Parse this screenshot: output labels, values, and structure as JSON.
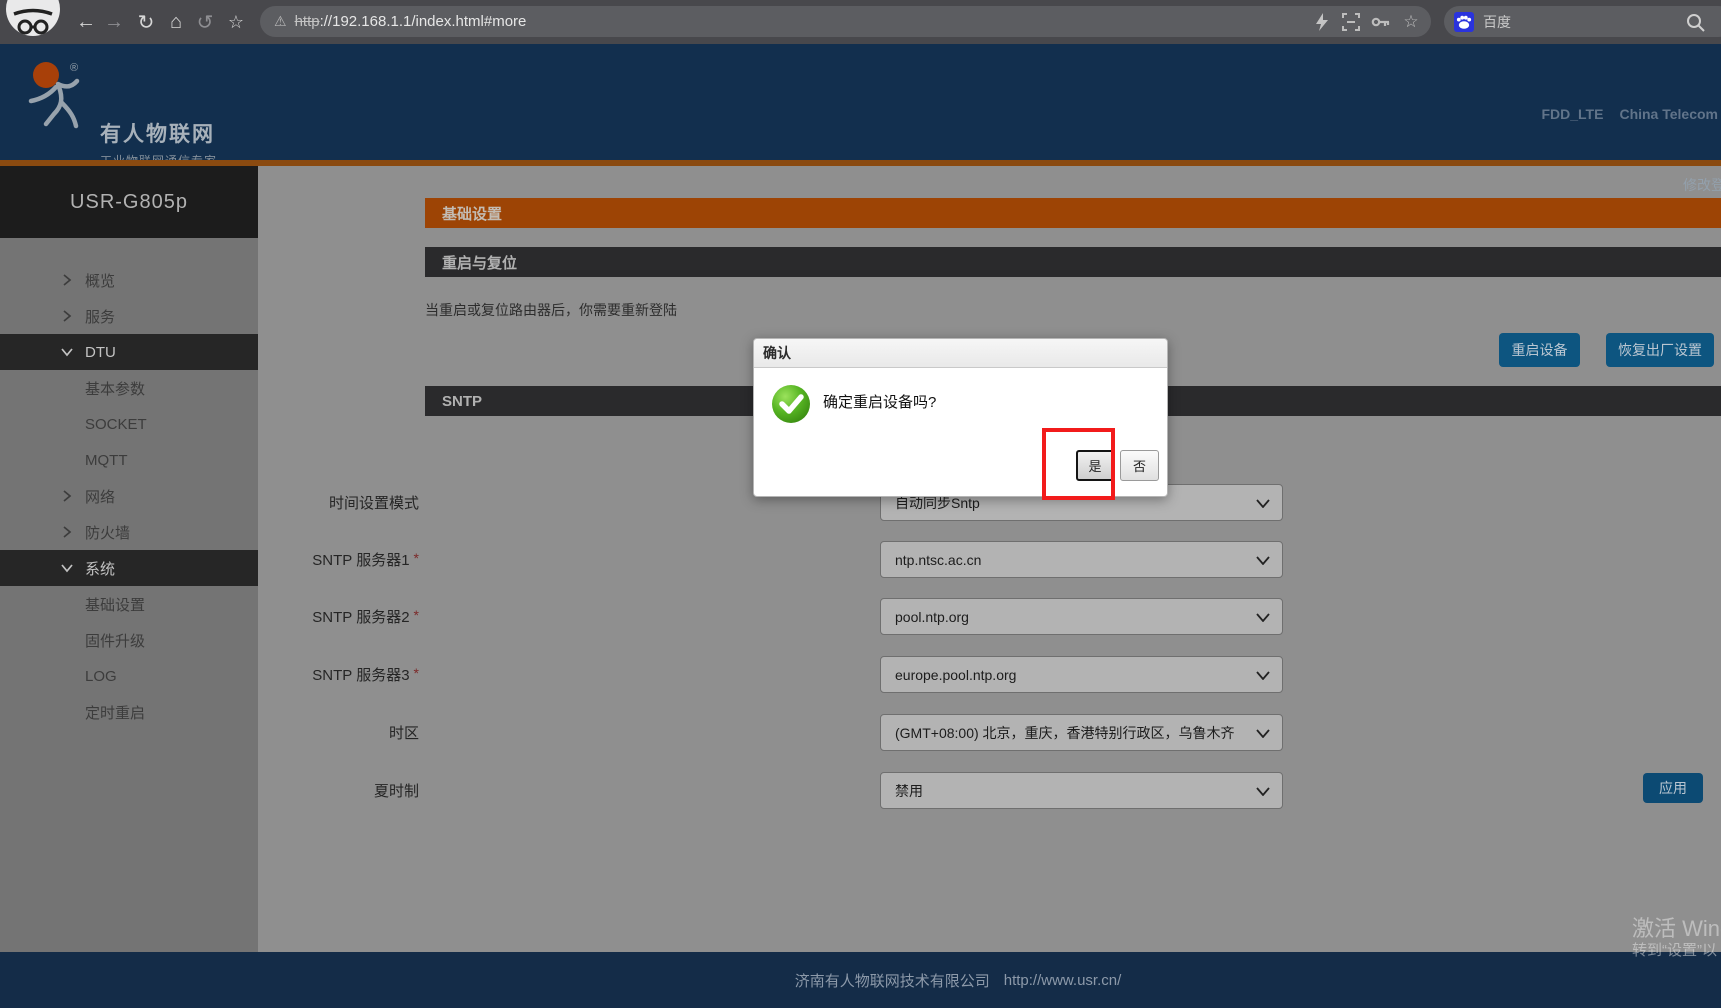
{
  "browser": {
    "url_scheme": "http",
    "url_rest": "://192.168.1.1/index.html#more",
    "warning_glyph": "⚠",
    "search_engine": "百度",
    "icons": [
      "back-arrow",
      "forward-arrow",
      "reload",
      "home",
      "rotate",
      "bookmark-star",
      "lightning",
      "reader-mode",
      "password-key",
      "star",
      "baidu-logo",
      "magnifier"
    ]
  },
  "header": {
    "brand_title": "有人物联网",
    "brand_subtitle": "工业物联网通信专家",
    "network_mode": "FDD_LTE",
    "carrier": "China Telecom",
    "change_password_link": "修改登"
  },
  "sidebar": {
    "device_model": "USR-G805p",
    "items": [
      {
        "label": "概览",
        "type": "parent",
        "state": "collapsed"
      },
      {
        "label": "服务",
        "type": "parent",
        "state": "collapsed"
      },
      {
        "label": "DTU",
        "type": "parent",
        "state": "expanded"
      },
      {
        "label": "基本参数",
        "type": "child"
      },
      {
        "label": "SOCKET",
        "type": "child"
      },
      {
        "label": "MQTT",
        "type": "child"
      },
      {
        "label": "网络",
        "type": "parent",
        "state": "collapsed"
      },
      {
        "label": "防火墙",
        "type": "parent",
        "state": "collapsed"
      },
      {
        "label": "系统",
        "type": "parent",
        "state": "expanded"
      },
      {
        "label": "基础设置",
        "type": "child"
      },
      {
        "label": "固件升级",
        "type": "child"
      },
      {
        "label": "LOG",
        "type": "child"
      },
      {
        "label": "定时重启",
        "type": "child"
      }
    ]
  },
  "content": {
    "page_title": "基础设置",
    "section_restart": "重启与复位",
    "restart_note": "当重启或复位路由器后，你需要重新登陆",
    "restart_button": "重启设备",
    "factory_reset_button": "恢复出厂设置",
    "section_sntp": "SNTP",
    "apply_button": "应用",
    "form": {
      "required_marker": "*",
      "rows": [
        {
          "label": "时间设置模式",
          "value": "自动同步Sntp"
        },
        {
          "label": "SNTP 服务器1",
          "value": "ntp.ntsc.ac.cn"
        },
        {
          "label": "SNTP 服务器2",
          "value": "pool.ntp.org"
        },
        {
          "label": "SNTP 服务器3",
          "value": "europe.pool.ntp.org"
        },
        {
          "label": "时区",
          "value": "(GMT+08:00) 北京，重庆，香港特别行政区，乌鲁木齐"
        },
        {
          "label": "夏时制",
          "value": "禁用"
        }
      ]
    }
  },
  "dialog": {
    "title": "确认",
    "message": "确定重启设备吗?",
    "yes_button": "是",
    "no_button": "否"
  },
  "footer": {
    "company": "济南有人物联网技术有限公司",
    "website": "http://www.usr.cn/"
  },
  "watermark": {
    "line1": "激活 Wind",
    "line2": "转到“设置”以"
  },
  "colors": {
    "accent_orange": "#9d4405",
    "header_navy": "#122f4e",
    "button_blue": "#0d5580",
    "annotation_red": "#f21b1b",
    "confirm_green": "#57b523"
  }
}
